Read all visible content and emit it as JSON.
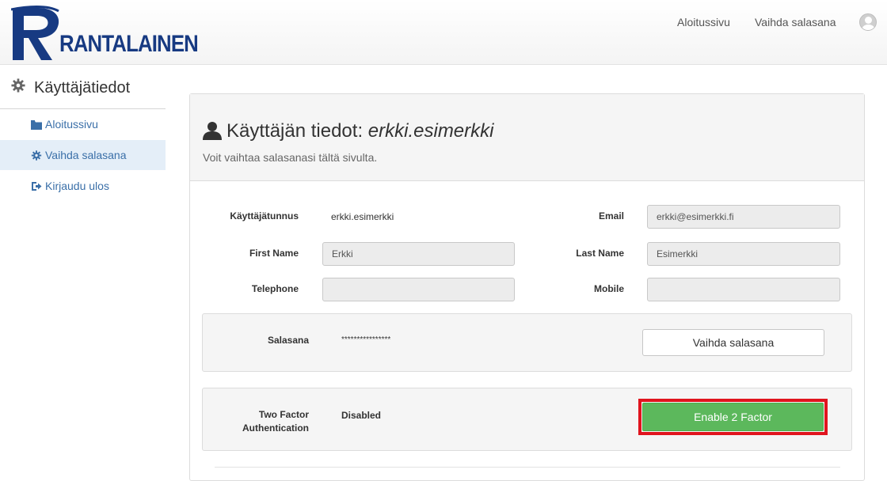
{
  "brand": {
    "name": "RANTALAINEN",
    "color": "#173a82"
  },
  "topnav": {
    "home": "Aloitussivu",
    "change_password": "Vaihda salasana",
    "avatar_icon": "user-avatar-icon"
  },
  "sidebar": {
    "title": "Käyttäjätiedot",
    "items": [
      {
        "label": "Aloitussivu",
        "icon": "folder-icon",
        "active": false
      },
      {
        "label": "Vaihda salasana",
        "icon": "gear-icon",
        "active": true
      },
      {
        "label": "Kirjaudu ulos",
        "icon": "sign-out-icon",
        "active": false
      }
    ]
  },
  "panel": {
    "title_prefix": "Käyttäjän tiedot:",
    "username_italic": "erkki.esimerkki",
    "subtitle": "Voit vaihtaa salasanasi tältä sivulta."
  },
  "fields": {
    "username_label": "Käyttäjätunnus",
    "username_value": "erkki.esimerkki",
    "email_label": "Email",
    "email_value": "erkki@esimerkki.fi",
    "first_name_label": "First Name",
    "first_name_value": "Erkki",
    "last_name_label": "Last Name",
    "last_name_value": "Esimerkki",
    "telephone_label": "Telephone",
    "telephone_value": "",
    "mobile_label": "Mobile",
    "mobile_value": ""
  },
  "password": {
    "label": "Salasana",
    "masked": "****************",
    "button": "Vaihda salasana"
  },
  "two_factor": {
    "label_line1": "Two Factor",
    "label_line2": "Authentication",
    "status": "Disabled",
    "button": "Enable 2 Factor"
  },
  "colors": {
    "accent_green": "#5cb85c",
    "highlight_red": "#e0141e",
    "link_blue": "#3a6fa8"
  }
}
